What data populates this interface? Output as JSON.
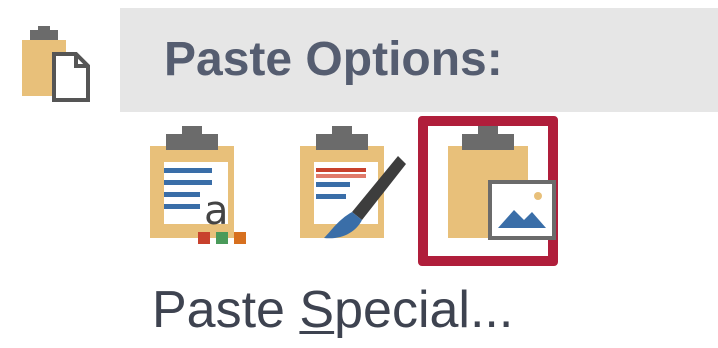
{
  "context_menu": {
    "section_title": "Paste Options:",
    "section_icon": "clipboard-paste-icon",
    "options": [
      {
        "id": "keep-text-only",
        "icon": "paste-keep-text-only-icon"
      },
      {
        "id": "merge-formatting",
        "icon": "paste-merge-formatting-icon"
      },
      {
        "id": "picture",
        "icon": "paste-as-picture-icon",
        "selected": true
      }
    ],
    "paste_special": {
      "label_prefix": "Paste ",
      "label_mnemonic": "S",
      "label_suffix": "pecial..."
    },
    "colors": {
      "header_background": "#e6e6e6",
      "header_text": "#555d70",
      "selection_border": "#b01e3b",
      "clipboard_body": "#e8c07a",
      "clipboard_clip": "#6b6b6b"
    }
  }
}
